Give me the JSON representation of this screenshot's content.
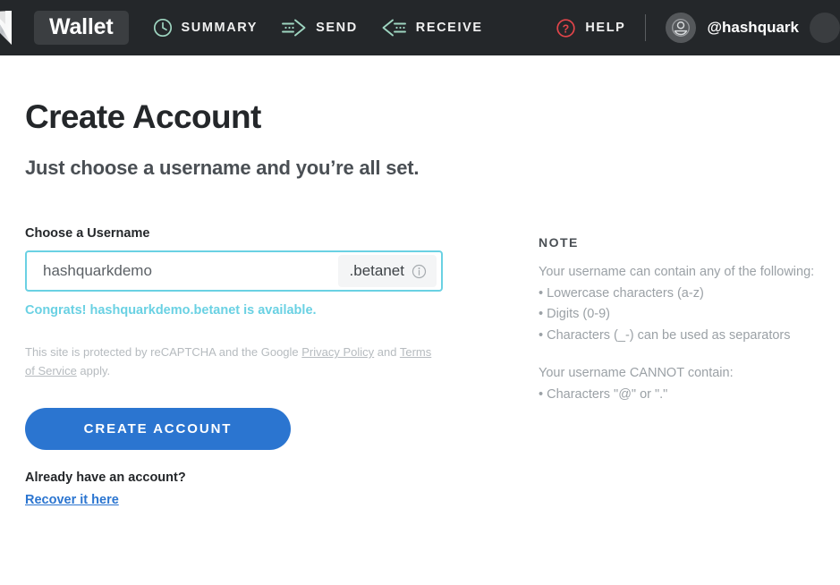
{
  "header": {
    "logo_icon": "near-logo-icon",
    "wallet_badge": "Wallet",
    "nav": [
      {
        "label": "SUMMARY",
        "icon": "clock-icon"
      },
      {
        "label": "SEND",
        "icon": "send-arrow-icon"
      },
      {
        "label": "RECEIVE",
        "icon": "receive-arrow-icon"
      }
    ],
    "help": {
      "label": "HELP",
      "icon": "question-circle-icon",
      "color": "#e2454a"
    },
    "user": {
      "name": "@hashquark",
      "icon": "user-avatar-icon"
    },
    "background": "#24272a",
    "accent_icon_color": "#9ed5c0"
  },
  "main": {
    "title": "Create Account",
    "subtitle": "Just choose a username and you’re all set.",
    "field": {
      "label": "Choose a Username",
      "value": "hashquarkdemo",
      "placeholder": "Enter username",
      "suffix": ".betanet",
      "info_icon": "info-circle-icon",
      "border_color": "#6ad1e3"
    },
    "status": {
      "message": "Congrats! hashquarkdemo.betanet is available.",
      "color": "#6ad1e3"
    },
    "recaptcha": {
      "before": "This site is protected by reCAPTCHA and the Google ",
      "privacy_link": "Privacy Policy",
      "middle": " and ",
      "terms_link": "Terms of Service",
      "after": " apply."
    },
    "create_button": {
      "label": "CREATE ACCOUNT",
      "color": "#2b75d0"
    },
    "have_account_text": "Already have an account?",
    "recover_link": "Recover it here"
  },
  "note": {
    "heading": "NOTE",
    "can_intro": "Your username can contain any of the following:",
    "can_items": [
      "• Lowercase characters (a-z)",
      "• Digits (0-9)",
      "• Characters (_-) can be used as separators"
    ],
    "cannot_intro": "Your username CANNOT contain:",
    "cannot_items": [
      "• Characters \"@\" or \".\""
    ]
  }
}
